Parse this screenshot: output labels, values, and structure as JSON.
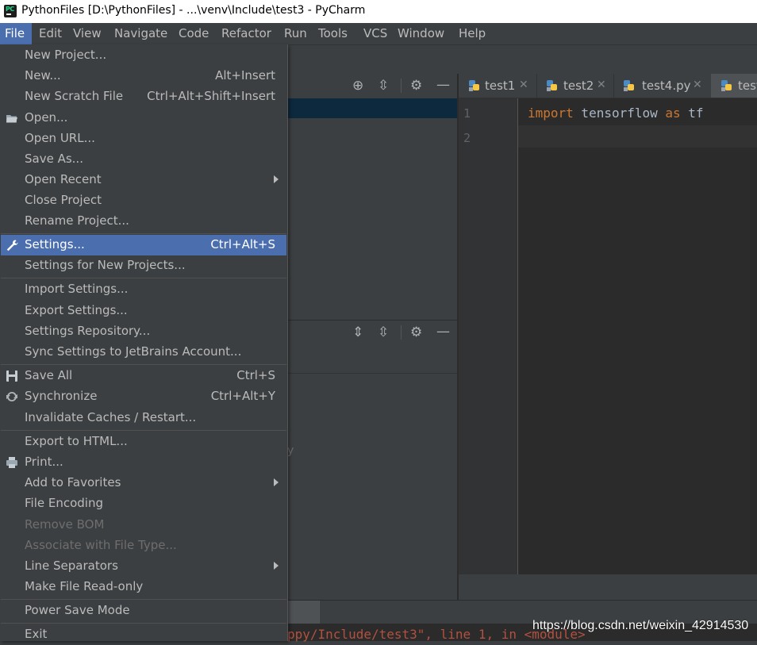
{
  "window": {
    "title": "PythonFiles [D:\\PythonFiles] - ...\\venv\\Include\\test3 - PyCharm",
    "app_icon_text": "PC"
  },
  "menubar": [
    "File",
    "Edit",
    "View",
    "Navigate",
    "Code",
    "Refactor",
    "Run",
    "Tools",
    "VCS",
    "Window",
    "Help"
  ],
  "file_menu": [
    {
      "label": "New Project...",
      "shortcut": "",
      "submenu": false
    },
    {
      "label": "New...",
      "shortcut": "Alt+Insert",
      "submenu": false
    },
    {
      "label": "New Scratch File",
      "shortcut": "Ctrl+Alt+Shift+Insert",
      "submenu": false
    },
    {
      "label": "Open...",
      "shortcut": "",
      "submenu": false,
      "icon": "folder-icon"
    },
    {
      "label": "Open URL...",
      "shortcut": "",
      "submenu": false
    },
    {
      "label": "Save As...",
      "shortcut": "",
      "submenu": false
    },
    {
      "label": "Open Recent",
      "shortcut": "",
      "submenu": true
    },
    {
      "label": "Close Project",
      "shortcut": "",
      "submenu": false
    },
    {
      "label": "Rename Project...",
      "shortcut": "",
      "submenu": false
    },
    {
      "label": "Settings...",
      "shortcut": "Ctrl+Alt+S",
      "submenu": false,
      "icon": "wrench-icon",
      "highlighted": true
    },
    {
      "label": "Settings for New Projects...",
      "shortcut": "",
      "submenu": false
    },
    {
      "label": "Import Settings...",
      "shortcut": "",
      "submenu": false
    },
    {
      "label": "Export Settings...",
      "shortcut": "",
      "submenu": false
    },
    {
      "label": "Settings Repository...",
      "shortcut": "",
      "submenu": false
    },
    {
      "label": "Sync Settings to JetBrains Account...",
      "shortcut": "",
      "submenu": false
    },
    {
      "label": "Save All",
      "shortcut": "Ctrl+S",
      "submenu": false,
      "icon": "save-icon"
    },
    {
      "label": "Synchronize",
      "shortcut": "Ctrl+Alt+Y",
      "submenu": false,
      "icon": "sync-icon"
    },
    {
      "label": "Invalidate Caches / Restart...",
      "shortcut": "",
      "submenu": false
    },
    {
      "label": "Export to HTML...",
      "shortcut": "",
      "submenu": false
    },
    {
      "label": "Print...",
      "shortcut": "",
      "submenu": false,
      "icon": "print-icon"
    },
    {
      "label": "Add to Favorites",
      "shortcut": "",
      "submenu": true
    },
    {
      "label": "File Encoding",
      "shortcut": "",
      "submenu": false
    },
    {
      "label": "Remove BOM",
      "shortcut": "",
      "submenu": false,
      "disabled": true
    },
    {
      "label": "Associate with File Type...",
      "shortcut": "",
      "submenu": false,
      "disabled": true
    },
    {
      "label": "Line Separators",
      "shortcut": "",
      "submenu": true
    },
    {
      "label": "Make File Read-only",
      "shortcut": "",
      "submenu": false
    },
    {
      "label": "Power Save Mode",
      "shortcut": "",
      "submenu": false
    },
    {
      "label": "Exit",
      "shortcut": "",
      "submenu": false
    }
  ],
  "editor": {
    "tabs": [
      "test1",
      "test2",
      "test4.py",
      "test"
    ],
    "line_numbers": [
      "1",
      "2"
    ],
    "code": {
      "kw1": "import",
      "mid": " tensorflow ",
      "kw2": "as",
      "tail": " tf"
    }
  },
  "console": {
    "text": "ppy/Include/test3\", line 1, in <module>"
  },
  "watermark": "https://blog.csdn.net/weixin_42914530",
  "faint_text": "y",
  "colors": {
    "menu_bg": "#3c3f41",
    "highlight": "#4b6eaf",
    "editor_bg": "#2b2b2b",
    "keyword": "#cc7832"
  }
}
